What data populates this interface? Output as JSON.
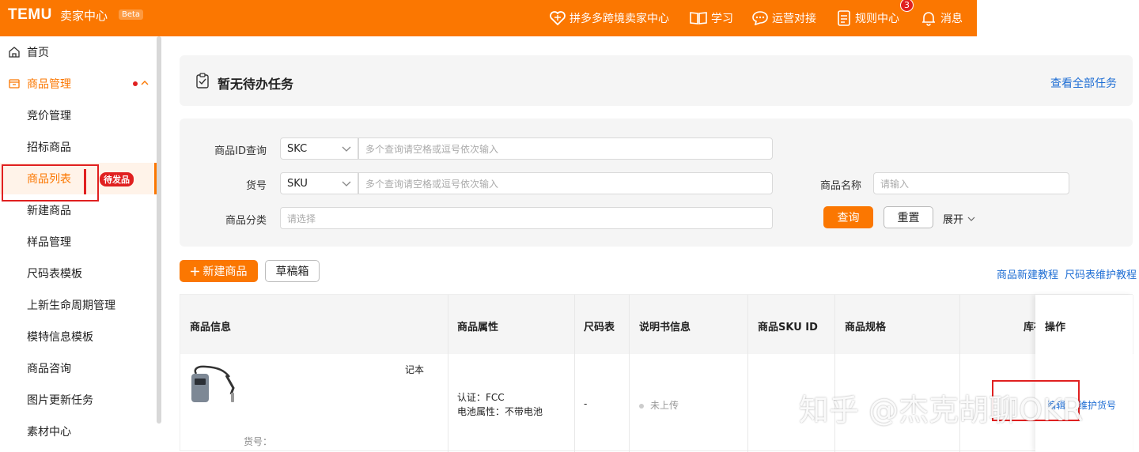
{
  "header": {
    "logo": "TEMU",
    "logo_sub": "卖家中心",
    "beta": "Beta",
    "nav": [
      {
        "label": "拼多多跨境卖家中心"
      },
      {
        "label": "学习"
      },
      {
        "label": "运营对接"
      },
      {
        "label": "规则中心",
        "badge": "3"
      },
      {
        "label": "消息"
      }
    ]
  },
  "sidebar": {
    "home": "首页",
    "group": "商品管理",
    "items": [
      "竞价管理",
      "招标商品",
      "商品列表",
      "新建商品",
      "样品管理",
      "尺码表模板",
      "上新生命周期管理",
      "模特信息模板",
      "商品咨询",
      "图片更新任务",
      "素材中心"
    ],
    "pending_badge": "待发品"
  },
  "todo": {
    "title": "暂无待办任务",
    "link": "查看全部任务"
  },
  "filter": {
    "id_label": "商品ID查询",
    "id_select": "SKC",
    "id_placeholder": "多个查询请空格或逗号依次输入",
    "sku_label": "货号",
    "sku_select": "SKU",
    "sku_placeholder": "多个查询请空格或逗号依次输入",
    "cat_label": "商品分类",
    "cat_placeholder": "请选择",
    "name_label": "商品名称",
    "name_placeholder": "请输入",
    "query": "查询",
    "reset": "重置",
    "expand": "展开"
  },
  "actions": {
    "new_product": "新建商品",
    "drafts": "草稿箱",
    "tutorial": "商品新建教程",
    "size_tutorial": "尺码表维护教程"
  },
  "table": {
    "headers": [
      "商品信息",
      "商品属性",
      "尺码表",
      "说明书信息",
      "商品SKU ID",
      "商品规格",
      "库存",
      "操作"
    ],
    "row": {
      "info_text": "记本",
      "goods_no": "货号：",
      "attr_1": "认证：FCC",
      "attr_2": "电池属性：不带电池",
      "size": "-",
      "manual": "未上传",
      "op_1": "编辑",
      "op_2": "维护货号"
    }
  },
  "watermark": "知乎 @杰克胡聊OKR",
  "colors": {
    "brand": "#fb7701",
    "link": "#1f6ed4",
    "alert": "#e02020"
  }
}
